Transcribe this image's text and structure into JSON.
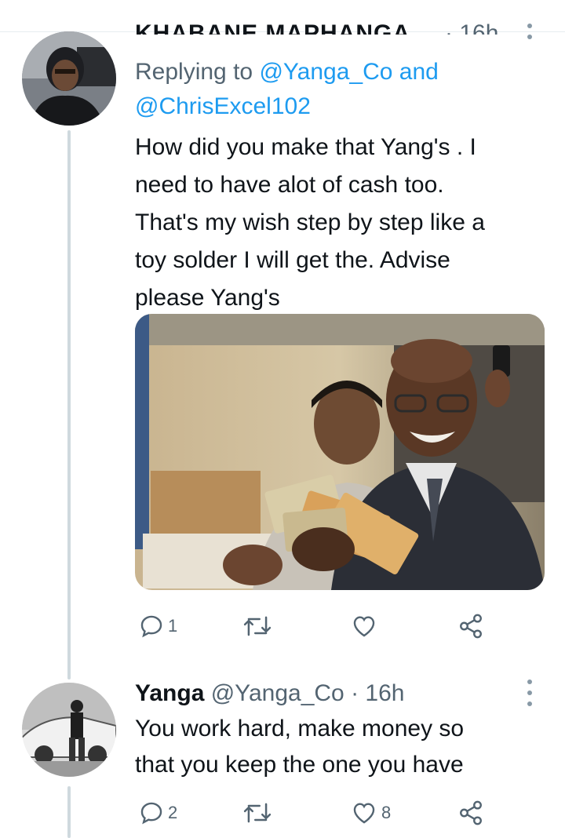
{
  "tweet1": {
    "author_name_cut": "KHABANE MAPHANGA",
    "time_cut": "· 16h",
    "reply_label": "Replying to",
    "reply_mention1": "@Yanga_Co",
    "reply_and": "and",
    "reply_mention2": "@ChrisExcel102",
    "text_lines": [
      "How did you make that Yang's . I",
      "need to have alot of cash too.",
      "That's my wish step by step like a",
      "toy solder I will get the. Advise",
      "please Yang's"
    ],
    "replies": "1",
    "retweets": "",
    "likes": ""
  },
  "tweet2": {
    "display_name": "Yanga",
    "handle": "@Yanga_Co",
    "sep": "·",
    "time": "16h",
    "text_lines": [
      "You work hard, make money so",
      "that you keep the one you have"
    ],
    "replies": "2",
    "retweets": "",
    "likes": "8"
  },
  "icons": [
    "reply-icon",
    "retweet-icon",
    "like-icon",
    "share-icon",
    "more-icon"
  ],
  "colors": {
    "accent": "#1d9bf0",
    "muted": "#536471",
    "text": "#0f1419",
    "thread_line": "#cfd9de"
  }
}
